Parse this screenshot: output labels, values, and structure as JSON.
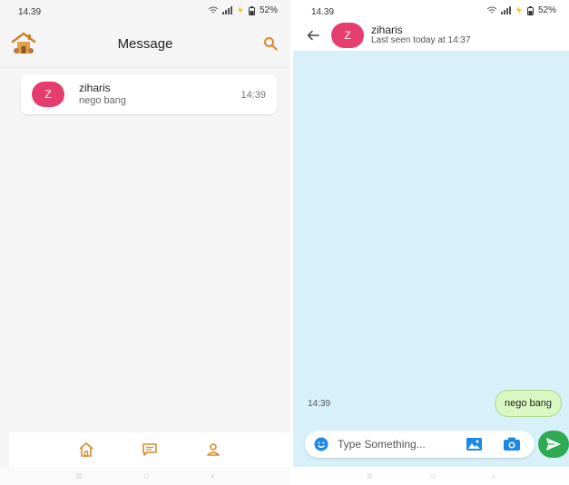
{
  "list_screen": {
    "status": {
      "time": "14.39",
      "battery": "52%"
    },
    "header": {
      "title": "Message"
    },
    "conversations": [
      {
        "initial": "Z",
        "name": "ziharis",
        "last_message": "nego bang",
        "time": "14:39"
      }
    ],
    "nav_icons": [
      "home-icon",
      "chat-icon",
      "profile-icon"
    ]
  },
  "chat_screen": {
    "status": {
      "time": "14.39",
      "battery": "52%"
    },
    "header": {
      "initial": "Z",
      "name": "ziharis",
      "status": "Last seen today at 14:37"
    },
    "messages": [
      {
        "time": "14:39",
        "text": "nego bang",
        "outgoing": true
      }
    ],
    "composer": {
      "placeholder": "Type Something..."
    }
  },
  "colors": {
    "accent": "#d98a2b",
    "avatar": "#e53d6e",
    "chat_background": "#d7f0fa",
    "outgoing_bubble": "#d9f7c2",
    "send_button": "#2eaa52",
    "composer_icons": "#1e88e5"
  }
}
